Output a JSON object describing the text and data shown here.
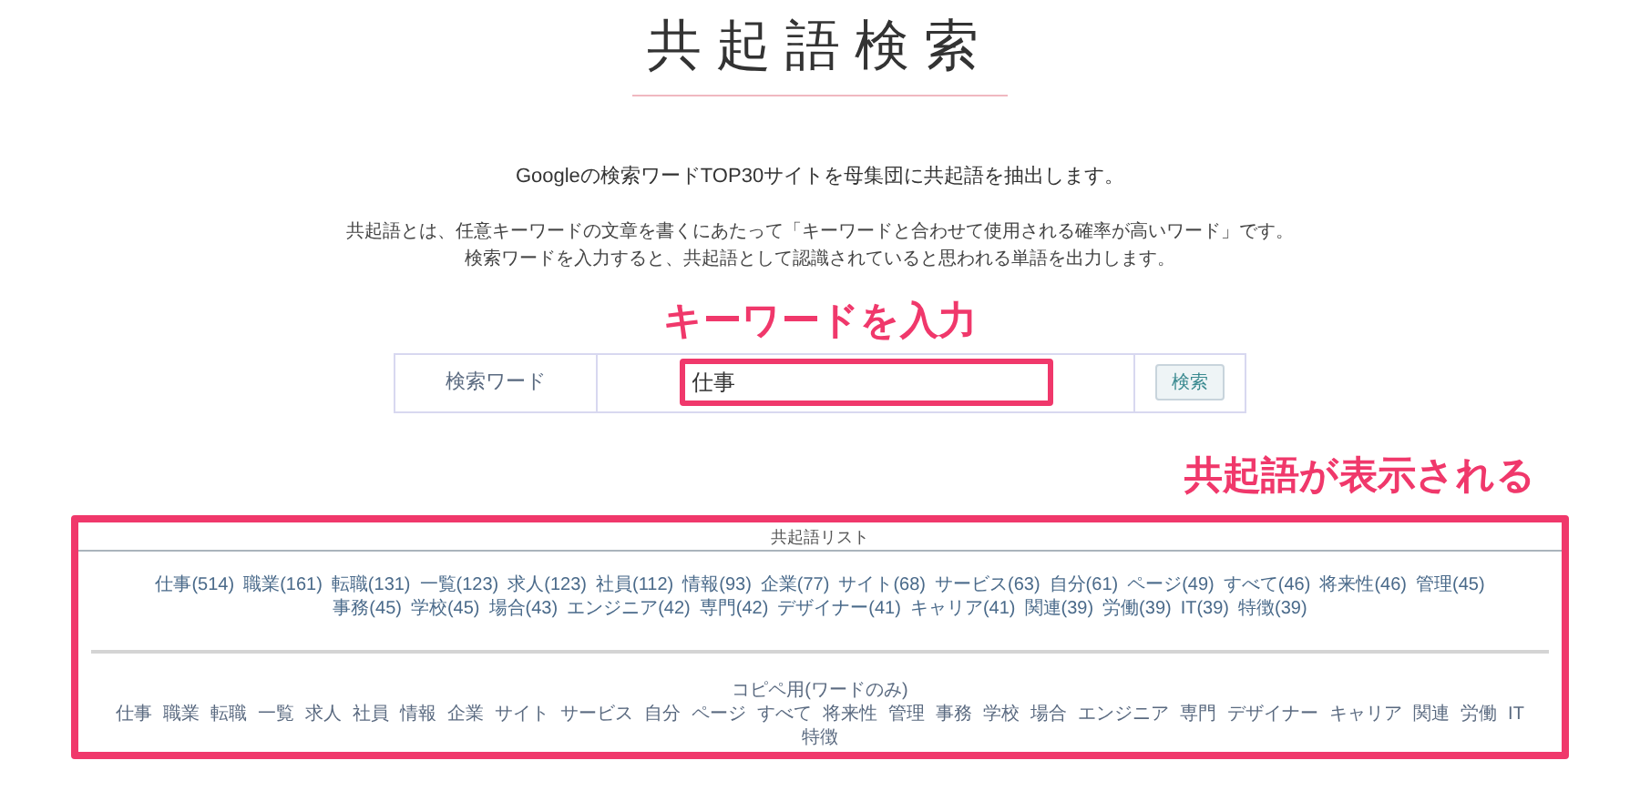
{
  "title": "共起語検索",
  "subtitle": "Googleの検索ワードTOP30サイトを母集団に共起語を抽出します。",
  "description": [
    "共起語とは、任意キーワードの文章を書くにあたって「キーワードと合わせて使用される確率が高いワード」です。",
    "検索ワードを入力すると、共起語として認識されていると思われる単語を出力します。"
  ],
  "annotations": [
    "キーワードを入力",
    "共起語が表示される"
  ],
  "search_form": {
    "label": "検索ワード",
    "value": "仕事",
    "button": "検索"
  },
  "results": {
    "heading": "共起語リスト",
    "words": [
      "仕事(514)",
      "職業(161)",
      "転職(131)",
      "一覧(123)",
      "求人(123)",
      "社員(112)",
      "情報(93)",
      "企業(77)",
      "サイト(68)",
      "サービス(63)",
      "自分(61)",
      "ページ(49)",
      "すべて(46)",
      "将来性(46)",
      "管理(45)",
      "事務(45)",
      "学校(45)",
      "場合(43)",
      "エンジニア(42)",
      "専門(42)",
      "デザイナー(41)",
      "キャリア(41)",
      "関連(39)",
      "労働(39)",
      "IT(39)",
      "特徴(39)"
    ],
    "copy_heading": "コピペ用(ワードのみ)",
    "copy_words": [
      "仕事",
      "職業",
      "転職",
      "一覧",
      "求人",
      "社員",
      "情報",
      "企業",
      "サイト",
      "サービス",
      "自分",
      "ページ",
      "すべて",
      "将来性",
      "管理",
      "事務",
      "学校",
      "場合",
      "エンジニア",
      "専門",
      "デザイナー",
      "キャリア",
      "関連",
      "労働",
      "IT",
      "特徴"
    ]
  }
}
